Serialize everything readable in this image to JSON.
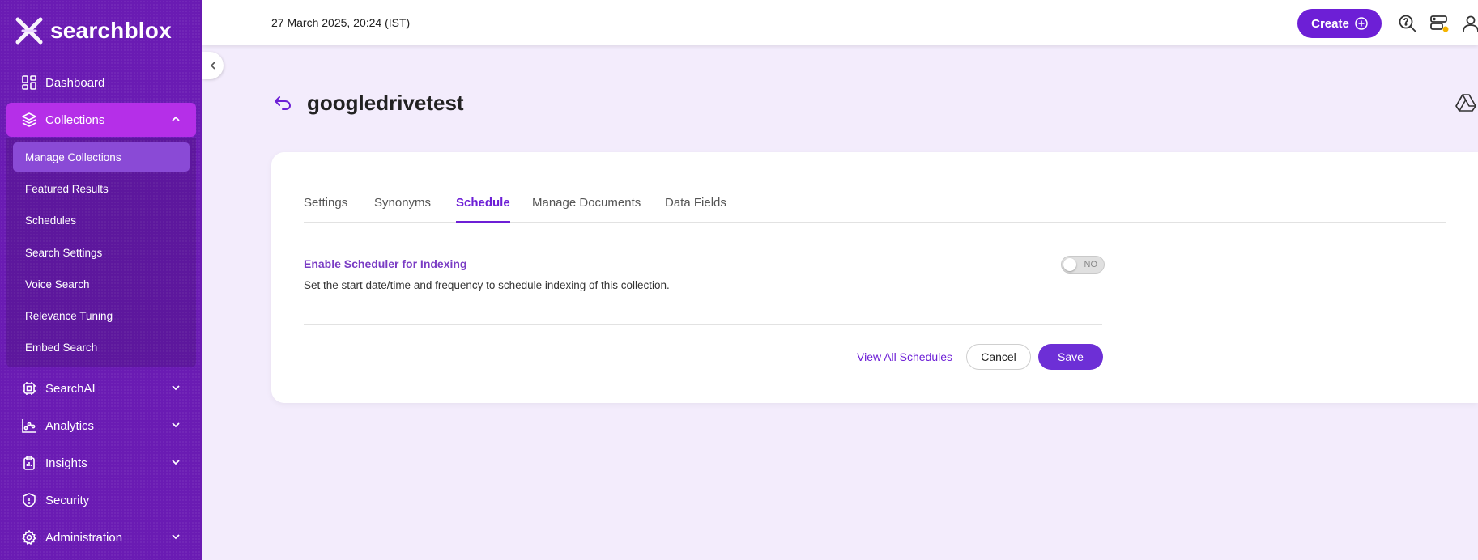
{
  "brand": {
    "name": "searchblox"
  },
  "topbar": {
    "datetime": "27 March 2025, 20:24 (IST)",
    "create_label": "Create"
  },
  "sidebar": {
    "items": [
      {
        "label": "Dashboard",
        "icon": "dashboard-icon"
      },
      {
        "label": "Collections",
        "icon": "layers-icon",
        "expanded": true
      },
      {
        "label": "SearchAI",
        "icon": "chip-icon"
      },
      {
        "label": "Analytics",
        "icon": "analytics-icon"
      },
      {
        "label": "Insights",
        "icon": "clipboard-icon"
      },
      {
        "label": "Security",
        "icon": "shield-icon"
      },
      {
        "label": "Administration",
        "icon": "gear-icon"
      }
    ],
    "collections_sub": [
      "Manage Collections",
      "Featured Results",
      "Schedules",
      "Search Settings",
      "Voice Search",
      "Relevance Tuning",
      "Embed Search"
    ],
    "active_sub": "Manage Collections"
  },
  "page": {
    "title": "googledrivetest"
  },
  "tabs": [
    "Settings",
    "Synonyms",
    "Schedule",
    "Manage Documents",
    "Data Fields"
  ],
  "active_tab": "Schedule",
  "scheduler": {
    "label": "Enable Scheduler for Indexing",
    "description": "Set the start date/time and frequency to schedule indexing of this collection.",
    "toggle_text": "NO",
    "enabled": false
  },
  "actions": {
    "view_all": "View All Schedules",
    "cancel": "Cancel",
    "save": "Save"
  },
  "colors": {
    "sidebar_bg": "#6a1bb3",
    "accent": "#6d1fd6",
    "active_nav": "#b52fe8",
    "page_bg": "#f3ecfc"
  }
}
